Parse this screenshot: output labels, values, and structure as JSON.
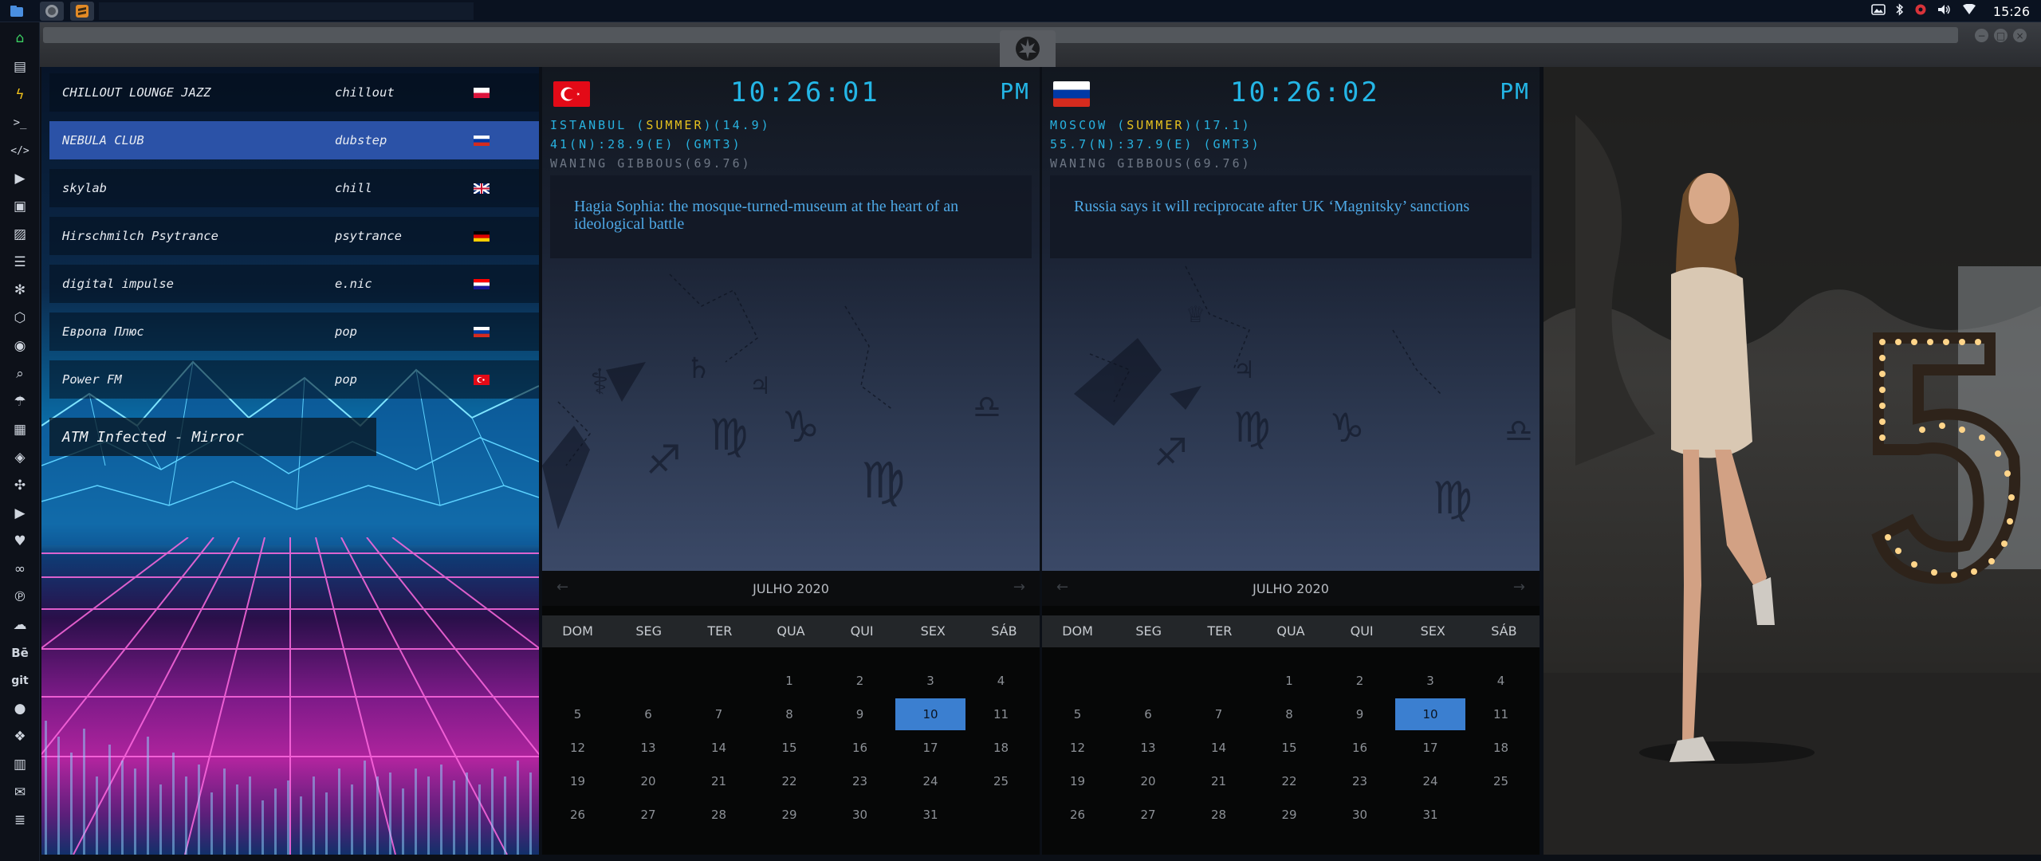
{
  "topbar": {
    "apps": [
      "files-app",
      "obs-app",
      "sublime-app"
    ],
    "clock": "15:26",
    "tray_icons": [
      "image-icon",
      "bluetooth-icon",
      "gear-red-icon",
      "volume-icon",
      "wifi-icon"
    ]
  },
  "dock": {
    "icons": [
      "home-icon",
      "document-icon",
      "bolt-icon",
      "terminal-icon",
      "code-icon",
      "play-circle-icon",
      "media-icon",
      "image-icon",
      "news-icon",
      "atom-icon",
      "hexagon-icon",
      "globe-icon",
      "search-icon",
      "umbrella-icon",
      "contact-card-icon",
      "tag-icon",
      "expand-icon",
      "youtube-icon",
      "heart-icon",
      "infinity-icon",
      "pinterest-icon",
      "cloud-icon",
      "behance-icon",
      "git-icon",
      "github-icon",
      "dropbox-icon",
      "map-icon",
      "mail-icon",
      "server-icon"
    ],
    "text_icons": {
      "behance": "Bē",
      "git": "git"
    }
  },
  "radio": {
    "stations": [
      {
        "name": "CHILLOUT LOUNGE JAZZ",
        "genre": "chillout",
        "flag": "poland"
      },
      {
        "name": "NEBULA CLUB",
        "genre": "dubstep",
        "flag": "russia"
      },
      {
        "name": "skylab",
        "genre": "chill",
        "flag": "uk"
      },
      {
        "name": "Hirschmilch Psytrance",
        "genre": "psytrance",
        "flag": "germany"
      },
      {
        "name": "digital impulse",
        "genre": "e.nic",
        "flag": "croatia"
      },
      {
        "name": "Европа Плюс",
        "genre": "pop",
        "flag": "russia"
      },
      {
        "name": "Power FM",
        "genre": "pop",
        "flag": "turkey"
      }
    ],
    "active_index": 1,
    "now_playing": "ATM Infected - Mirror"
  },
  "cities": [
    {
      "flag": "turkey",
      "time": "10:26:01",
      "ampm": "PM",
      "city": "ISTANBUL",
      "season": "SUMMER",
      "temp": "(14.9)",
      "coords": "41(N):28.9(E) (GMT3)",
      "moon": "WANING GIBBOUS(69.76)",
      "headline": "Hagia Sophia: the mosque-turned-museum at the heart of an ideological battle"
    },
    {
      "flag": "russia",
      "time": "10:26:02",
      "ampm": "PM",
      "city": "MOSCOW",
      "season": "SUMMER",
      "temp": "(17.1)",
      "coords": "55.7(N):37.9(E) (GMT3)",
      "moon": "WANING GIBBOUS(69.76)",
      "headline": "Russia says it will reciprocate after UK ‘Magnitsky’ sanctions"
    }
  ],
  "calendar": {
    "month": "JULHO 2020",
    "prev": "←",
    "next": "→",
    "weekdays": [
      "DOM",
      "SEG",
      "TER",
      "QUA",
      "QUI",
      "SEX",
      "SÁB"
    ],
    "first_weekday": 3,
    "days_in_month": 31,
    "selected_day": 10,
    "colors": {
      "selected": "#3b7fd0"
    }
  },
  "colors": {
    "accent_cyan": "#24b6e6",
    "accent_yellow": "#e7c21f",
    "radio_active": "#2b52a7"
  }
}
